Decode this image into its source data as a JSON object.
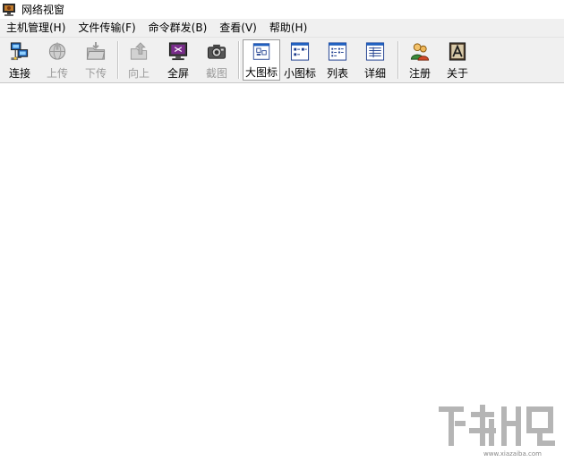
{
  "window": {
    "title": "网络视窗"
  },
  "menu": [
    "主机管理(H)",
    "文件传输(F)",
    "命令群发(B)",
    "查看(V)",
    "帮助(H)"
  ],
  "toolbar": {
    "connect": "连接",
    "upload": "上传",
    "download": "下传",
    "up": "向上",
    "fullscreen": "全屏",
    "screenshot": "截图",
    "large_icons": "大图标",
    "small_icons": "小图标",
    "list": "列表",
    "details": "详细",
    "register": "注册",
    "about": "关于"
  },
  "watermark": {
    "url": "www.xiazaiba.com"
  }
}
